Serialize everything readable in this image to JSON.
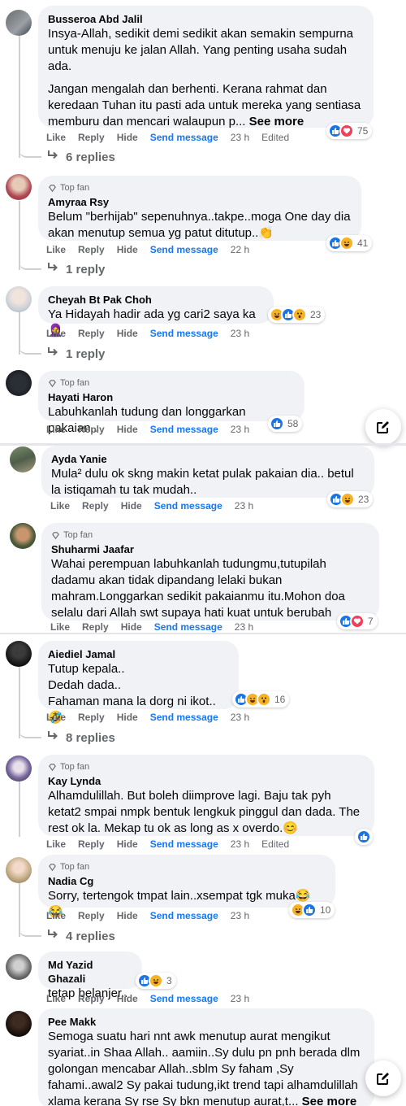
{
  "labels": {
    "like": "Like",
    "reply": "Reply",
    "hide": "Hide",
    "send_message": "Send message",
    "edited": "Edited",
    "top_fan": "Top fan",
    "see_more": "See more"
  },
  "colors": {
    "link_blue": "#1877f2",
    "muted": "#65676b",
    "bubble": "#f0f2f5"
  },
  "comments": [
    {
      "name": "Busseroa Abd Jalil",
      "top_fan": false,
      "text1": "Insya-Allah, sedikit demi sedikit akan semakin sempurna untuk menuju ke jalan Allah. Yang penting usaha sudah ada.",
      "text2": "Jangan mengalah dan berhenti. Kerana rahmat dan keredaan Tuhan itu pasti ada untuk mereka yang sentiasa memburu dan mencari walaupun p...",
      "time": "23 h",
      "edited": true,
      "reactions": [
        "like",
        "love"
      ],
      "reaction_count": "75",
      "replies": "6 replies"
    },
    {
      "name": "Amyraa Rsy",
      "top_fan": true,
      "text1": "Belum \"berhijab\" sepenuhnya..takpe..moga One day dia akan menutup semua yg patut ditutup..👏",
      "time": "22 h",
      "reactions": [
        "like",
        "haha"
      ],
      "reaction_count": "41",
      "replies": "1 reply"
    },
    {
      "name": "Cheyah Bt Pak Choh",
      "top_fan": false,
      "text1": "Ya Hidayah hadir ada yg cari2 saya ka🧕",
      "time": "23 h",
      "reactions": [
        "haha",
        "like",
        "wow"
      ],
      "reaction_count": "23",
      "replies": "1 reply"
    },
    {
      "name": "Hayati Haron",
      "top_fan": true,
      "text1": "Labuhkanlah tudung dan longgarkan pakaian..",
      "time": "23 h",
      "reactions": [
        "like"
      ],
      "reaction_count": "58"
    },
    {
      "name": "Ayda Yanie",
      "top_fan": false,
      "text1": "Mula² dulu ok skng makin ketat pulak pakaian dia.. betul la istiqamah tu tak mudah..",
      "time": "23 h",
      "reactions": [
        "like",
        "haha"
      ],
      "reaction_count": "23"
    },
    {
      "name": "Shuharmi Jaafar",
      "top_fan": true,
      "text1": "Wahai perempuan labuhkanlah tudungmu,tutupilah dadamu akan tidak dipandang lelaki bukan mahram.Longgarkan sedikit pakaianmu itu.Mohon doa selalu dari Allah swt supaya hati kuat untuk berubah",
      "time": "23 h",
      "reactions": [
        "like",
        "love"
      ],
      "reaction_count": "7"
    },
    {
      "name": "Aiediel Jamal",
      "top_fan": false,
      "text1": "Tutup kepala..\nDedah dada..\nFahaman mana la dorg ni ikot..🤣",
      "time": "23 h",
      "reactions": [
        "like",
        "haha",
        "wow"
      ],
      "reaction_count": "16",
      "replies": "8 replies"
    },
    {
      "name": "Kay Lynda",
      "top_fan": true,
      "text1": "Alhamdulillah. But boleh diimprove lagi. Baju tak pyh ketat2 smpai nmpk bentuk lengkuk pinggul dan dada. The rest ok la. Mekap tu ok as long as x overdo.😊",
      "time": "23 h",
      "edited": true,
      "reactions": [
        "like"
      ],
      "reaction_count": ""
    },
    {
      "name": "Nadia Cg",
      "top_fan": true,
      "text1": "Sorry, tertengok tmpat lain..xsempat tgk muka😂😂",
      "time": "23 h",
      "reactions": [
        "haha",
        "like"
      ],
      "reaction_count": "10",
      "replies": "4 replies"
    },
    {
      "name": "Md Yazid Ghazali",
      "top_fan": false,
      "text1": "tetap belanjer..",
      "time": "23 h",
      "reactions": [
        "like",
        "haha"
      ],
      "reaction_count": "3"
    },
    {
      "name": "Pee Makk",
      "top_fan": false,
      "text1": "Semoga suatu hari nnt awk menutup aurat mengikut syariat..in Shaa Allah.. aamiin..Sy dulu pn pnh berada dlm golongan mencabar Allah..sblm Sy faham ,Sy fahami..awal2 Sy pakai tudung,ikt trend tapi alhamdulillah xlama kerana Sy rse Sy bkn menutup aurat,t..."
    }
  ]
}
